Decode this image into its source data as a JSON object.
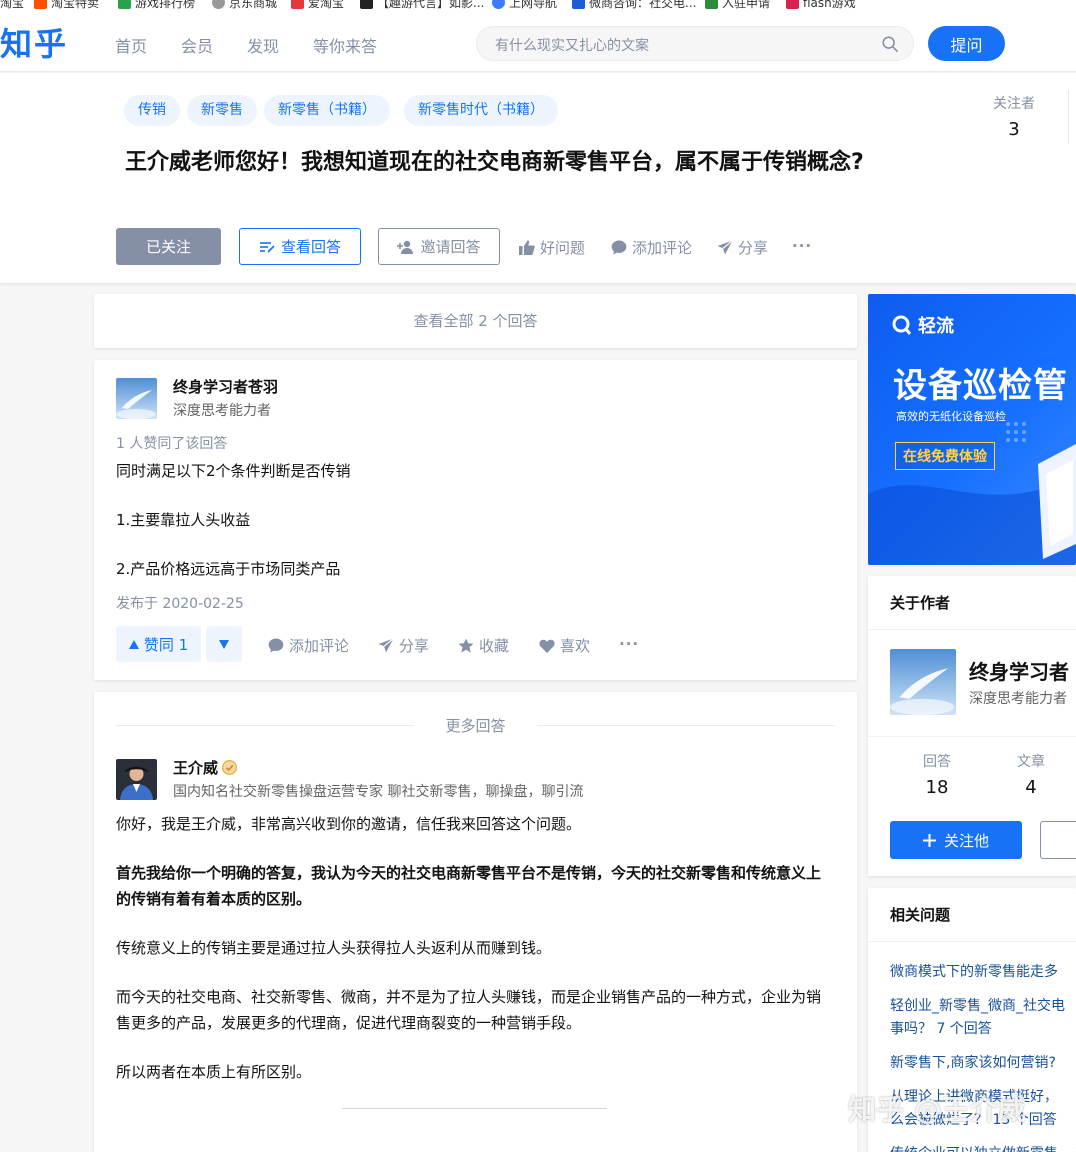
{
  "bookmarks": [
    "淘宝",
    "淘宝特卖",
    "游戏排行榜",
    "京东商城",
    "爱淘宝",
    "【趣游代言】如影...",
    "上网导航",
    "微商咨询：社交电...",
    "入驻申请",
    "flash游戏"
  ],
  "header": {
    "logo": "知乎",
    "nav": [
      "首页",
      "会员",
      "发现",
      "等你来答"
    ],
    "search_placeholder": "有什么现实又扎心的文案",
    "ask_label": "提问"
  },
  "question": {
    "tags": [
      "传销",
      "新零售",
      "新零售（书籍）",
      "新零售时代（书籍）"
    ],
    "title": "王介威老师您好！我想知道现在的社交电商新零售平台，属不属于传销概念?",
    "followers_label": "关注者",
    "followers_count": "3",
    "followed_label": "已关注",
    "view_answers_label": "查看回答",
    "invite_label": "邀请回答",
    "good_question_label": "好问题",
    "comment_label": "添加评论",
    "share_label": "分享",
    "more_label": "···"
  },
  "view_all": "查看全部 2 个回答",
  "answer1": {
    "author": "终身学习者苍羽",
    "bio": "深度思考能力者",
    "votes_note": "1 人赞同了该回答",
    "paragraphs": [
      "同时满足以下2个条件判断是否传销",
      "1.主要靠拉人头收益",
      "2.产品价格远远高于市场同类产品"
    ],
    "date": "发布于 2020-02-25",
    "upvote_label": "赞同 1",
    "actions": [
      "添加评论",
      "分享",
      "收藏",
      "喜欢",
      "···"
    ]
  },
  "answer2": {
    "section_label": "更多回答",
    "author": "王介威",
    "bio": "国内知名社交新零售操盘运营专家 聊社交新零售，聊操盘，聊引流",
    "paragraphs": [
      "你好，我是王介威，非常高兴收到你的邀请，信任我来回答这个问题。",
      "首先我给你一个明确的答复，我认为今天的社交电商新零售平台不是传销，今天的社交新零售和传统意义上的传销有着有着本质的区别。",
      "传统意义上的传销主要是通过拉人头获得拉人头返利从而赚到钱。",
      "而今天的社交电商、社交新零售、微商，并不是为了拉人头赚钱，而是企业销售产品的一种方式，企业为销售更多的产品，发展更多的代理商，促进代理商裂变的一种营销手段。",
      "所以两者在本质上有所区别。"
    ]
  },
  "ad": {
    "brand": "轻流",
    "title": "设备巡检管",
    "subtitle": "高效的无纸化设备巡检",
    "cta": "在线免费体验"
  },
  "about_author": {
    "title": "关于作者",
    "name": "终身学习者",
    "bio": "深度思考能力者",
    "answers_label": "回答",
    "answers_count": "18",
    "articles_label": "文章",
    "articles_count": "4",
    "follow_label": "关注他"
  },
  "related": {
    "title": "相关问题",
    "items": [
      "微商模式下的新零售能走多",
      "轻创业_新零售_微商_社交电",
      "事吗？ 7 个回答",
      "新零售下,商家该如何营销?",
      "从理论上讲微商模式挺好，",
      "么会被做烂了？ 13 个回答",
      "传统企业可以独立做新零售"
    ]
  },
  "watermark": "知乎 @王介威",
  "colors": {
    "accent": "#1772f6",
    "muted": "#8590a6",
    "link": "#175199"
  }
}
